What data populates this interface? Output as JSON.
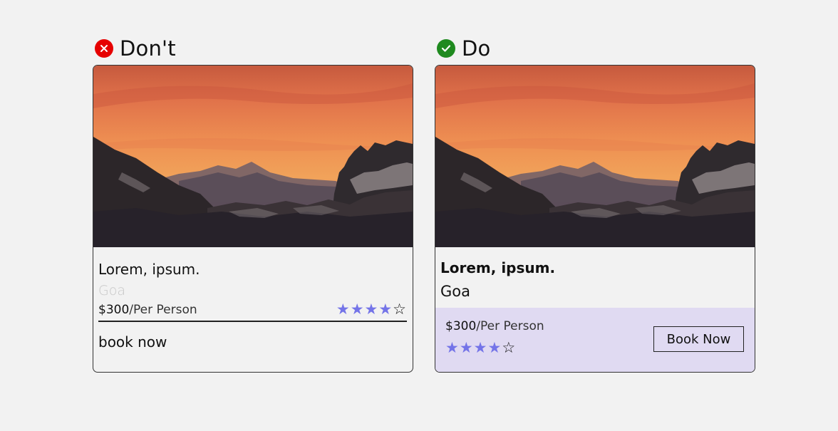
{
  "dont": {
    "heading": "Don't",
    "title": "Lorem, ipsum.",
    "location": "Goa",
    "price": "$300",
    "price_unit": "/Per Person",
    "rating": 4,
    "rating_max": 5,
    "cta": "book now"
  },
  "do": {
    "heading": "Do",
    "title": "Lorem, ipsum.",
    "location": "Goa",
    "price": "$300",
    "price_unit": "/Per Person",
    "rating": 4,
    "rating_max": 5,
    "cta": "Book Now"
  },
  "icons": {
    "dont": "close-circle-icon",
    "do": "check-circle-icon",
    "image": "mountain-sunset-photo"
  },
  "colors": {
    "dont_badge": "#e60000",
    "do_badge": "#1f8a1f",
    "star": "#7474e8",
    "do_footer_bg": "#e0daf2",
    "page_bg": "#f2f2f2"
  }
}
